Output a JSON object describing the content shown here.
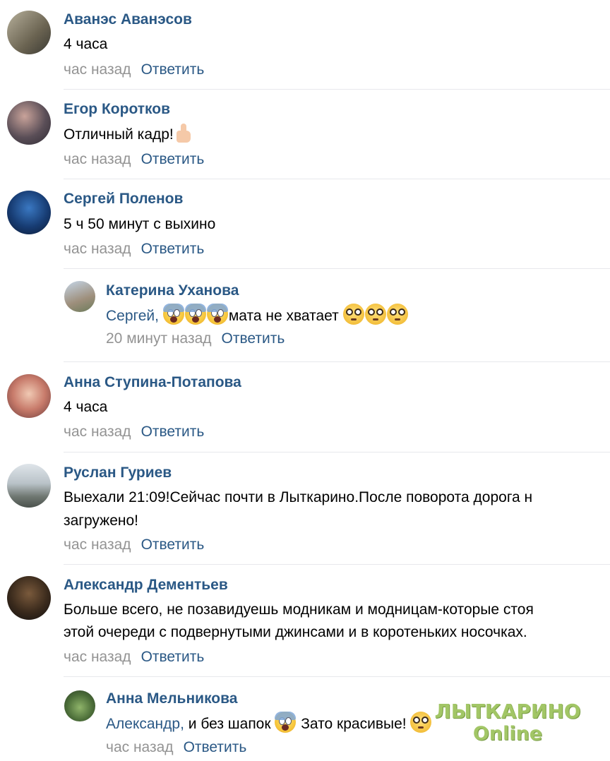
{
  "comments": [
    {
      "author": "Аванэс Аванэсов",
      "text": "4 часа",
      "time": "час назад",
      "reply": "Ответить"
    },
    {
      "author": "Егор Коротков",
      "text": "Отличный кадр!",
      "emoji": "thumbs-up",
      "time": "час назад",
      "reply": "Ответить"
    },
    {
      "author": "Сергей Поленов",
      "text": "5 ч 50 минут с выхино",
      "time": "час назад",
      "reply": "Ответить"
    },
    {
      "author": "Катерина Уханова",
      "mention": "Сергей,",
      "text": "мата не хватает",
      "time": "20 минут назад",
      "reply": "Ответить"
    },
    {
      "author": "Анна Ступина-Потапова",
      "text": "4 часа",
      "time": "час назад",
      "reply": "Ответить"
    },
    {
      "author": "Руслан Гуриев",
      "text_line1": "Выехали 21:09!Сейчас почти в Лыткарино.После поворота дорога н",
      "text_line2": "загружено!",
      "time": "час назад",
      "reply": "Ответить"
    },
    {
      "author": "Александр Дементьев",
      "text_line1": "Больше всего, не позавидуешь модникам и модницам-которые стоя",
      "text_line2": "этой очереди с подвернутыми джинсами и в коротеньких носочках.",
      "time": "час назад",
      "reply": "Ответить"
    },
    {
      "author": "Анна Мельникова",
      "mention": "Александр,",
      "text_a": "и без шапок",
      "text_b": "Зато красивые!",
      "time": "час назад",
      "reply": "Ответить"
    }
  ],
  "watermark": {
    "line1": "ЛЫТКАРИНО",
    "line2": "Online"
  },
  "colors": {
    "link": "#2a5885",
    "muted": "#939393",
    "separator": "#e7e8ec",
    "watermark": "#9bc25a"
  }
}
